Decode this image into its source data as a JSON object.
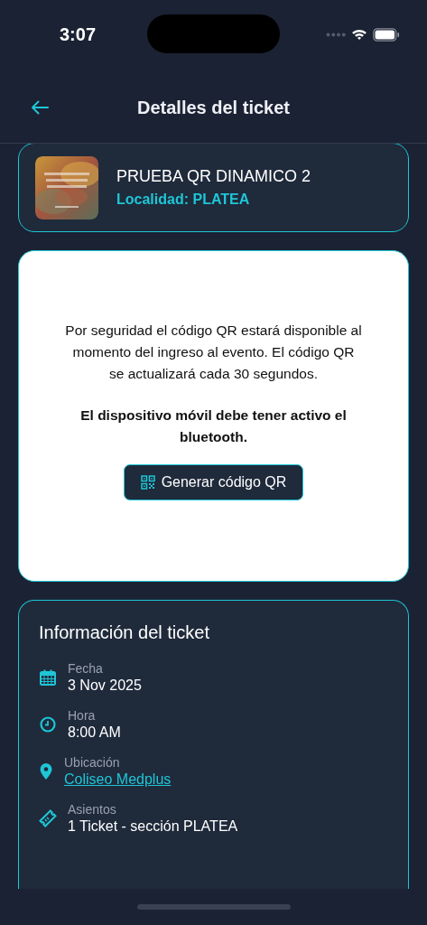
{
  "status_bar": {
    "time": "3:07"
  },
  "header": {
    "title": "Detalles del ticket"
  },
  "event": {
    "name": "PRUEBA QR DINAMICO 2",
    "locality": "Localidad: PLATEA"
  },
  "qr_panel": {
    "notice": "Por seguridad el código QR estará disponible al momento del ingreso al evento. El código QR se actualizará cada 30 segundos.",
    "warning": "El dispositivo móvil debe tener activo el bluetooth.",
    "button": "Generar código QR"
  },
  "info": {
    "title": "Información del ticket",
    "rows": [
      {
        "kind": "date",
        "label": "Fecha",
        "value": "3 Nov 2025"
      },
      {
        "kind": "time",
        "label": "Hora",
        "value": "8:00 AM"
      },
      {
        "kind": "location",
        "label": "Ubicación",
        "value": "Coliseo Medplus"
      },
      {
        "kind": "seats",
        "label": "Asientos",
        "value": "1 Ticket - sección PLATEA"
      }
    ]
  }
}
